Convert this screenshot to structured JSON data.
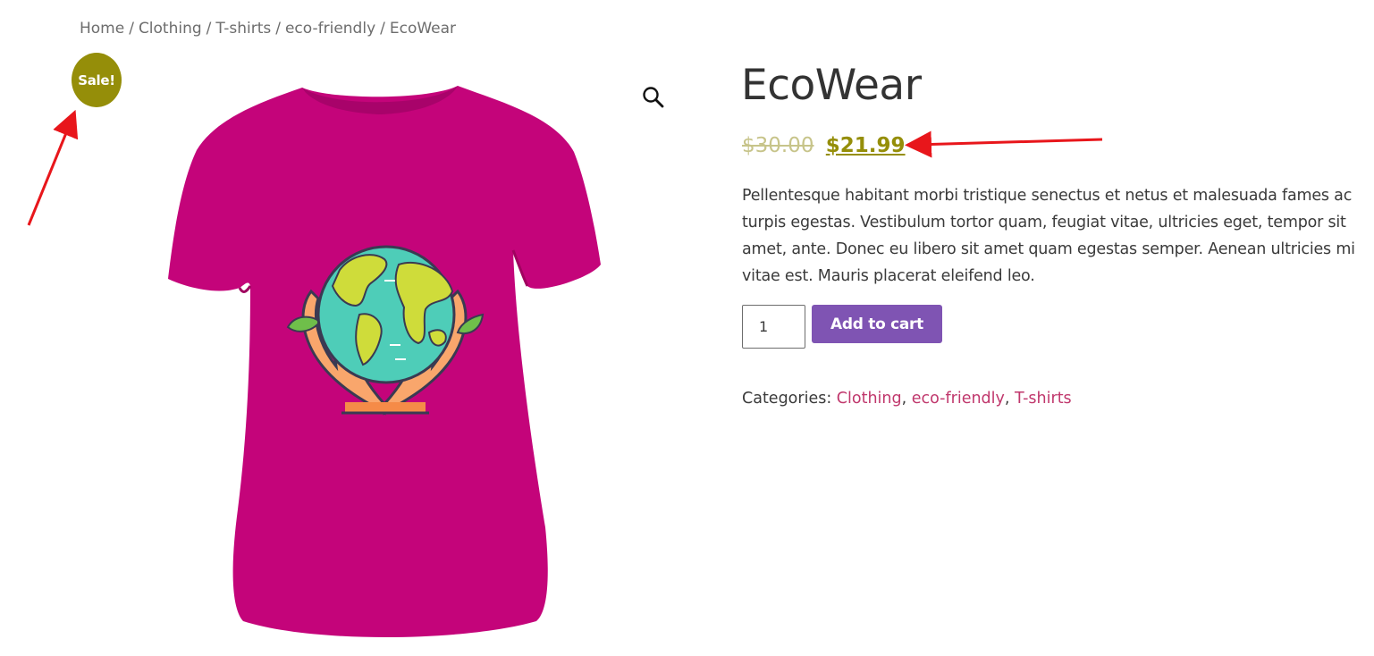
{
  "breadcrumb": {
    "items": [
      "Home",
      "Clothing",
      "T-shirts",
      "eco-friendly"
    ],
    "separator": "/",
    "current": "EcoWear"
  },
  "badge": {
    "sale_label": "Sale!",
    "color": "#958e09"
  },
  "gallery": {
    "zoom_icon": "magnifier-icon",
    "shirt_color": "#c4047a",
    "image_subject": "earth-in-hands-icon"
  },
  "product": {
    "title": "EcoWear",
    "price": {
      "regular": "$30.00",
      "sale": "$21.99",
      "sale_color": "#958e09"
    },
    "description": "Pellentesque habitant morbi tristique senectus et netus et malesuada fames ac turpis egestas. Vestibulum tortor quam, feugiat vitae, ultricies eget, tempor sit amet, ante. Donec eu libero sit amet quam egestas semper. Aenean ultricies mi vitae est. Mauris placerat eleifend leo.",
    "quantity": "1",
    "add_to_cart_label": "Add to cart",
    "button_color": "#7f54b3",
    "categories_label": "Categories:",
    "categories": [
      "Clothing",
      "eco-friendly",
      "T-shirts"
    ],
    "link_color": "#c0376c"
  },
  "annotations": {
    "arrow_color": "#e8161b"
  }
}
